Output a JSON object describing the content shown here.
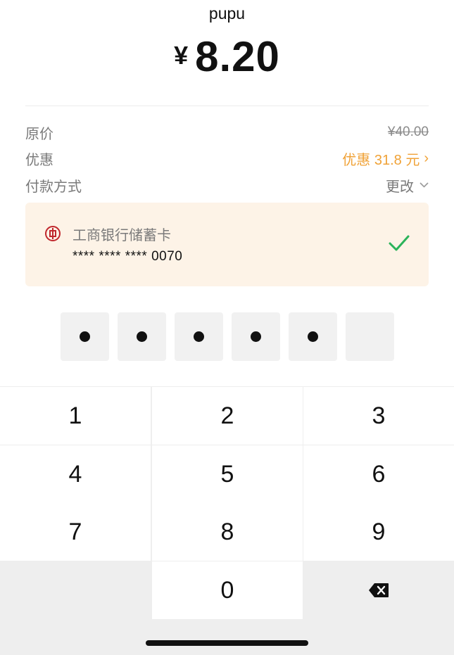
{
  "merchant": "pupu",
  "currency_symbol": "¥",
  "amount": "8.20",
  "details": {
    "original_label": "原价",
    "original_price": "¥40.00",
    "discount_label": "优惠",
    "discount_value": "优惠 31.8 元",
    "method_label": "付款方式",
    "change_label": "更改"
  },
  "card": {
    "bank_name": "工商银行储蓄卡",
    "number": "**** **** **** 0070",
    "icon": "icbc-bank-icon",
    "selected_icon": "check-icon",
    "accent_color": "#c0272d",
    "check_color": "#2bb35a"
  },
  "pin": {
    "total_digits": 6,
    "entered_digits": 5
  },
  "keypad": {
    "keys": [
      "1",
      "2",
      "3",
      "4",
      "5",
      "6",
      "7",
      "8",
      "9",
      "",
      "0",
      "delete"
    ]
  },
  "colors": {
    "discount": "#f0a237",
    "card_background": "#fdf3e7",
    "keypad_background": "#eeeeee"
  }
}
